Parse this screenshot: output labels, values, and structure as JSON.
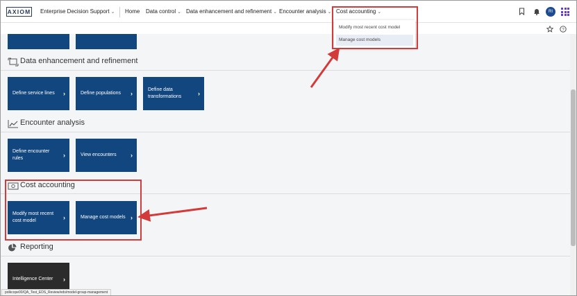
{
  "header": {
    "logo": "AXIOM",
    "product": "Enterprise Decision Support",
    "nav": [
      {
        "label": "Home",
        "has_menu": false
      },
      {
        "label": "Data control",
        "has_menu": true
      },
      {
        "label": "Data enhancement and refinement",
        "has_menu": true
      },
      {
        "label": "Encounter analysis",
        "has_menu": true
      },
      {
        "label": "Cost accounting",
        "has_menu": true
      }
    ],
    "avatar_initials": "RI",
    "icons": [
      "bookmark-icon",
      "bell-icon",
      "avatar",
      "apps-grid-icon"
    ]
  },
  "dropdown": {
    "items": [
      "Modify most recent cost model",
      "Manage cost models"
    ],
    "active_index": 1
  },
  "secondary_icons": [
    "star-icon",
    "help-icon"
  ],
  "sections": [
    {
      "title": "Data enhancement and refinement",
      "icon": "data-enhancement-icon",
      "tiles": [
        "Define service lines",
        "Define populations",
        "Define data transformations"
      ]
    },
    {
      "title": "Encounter analysis",
      "icon": "line-chart-icon",
      "tiles": [
        "Define encounter rules",
        "View encounters"
      ]
    },
    {
      "title": "Cost accounting",
      "icon": "cost-accounting-icon",
      "tiles": [
        "Modify most recent cost model",
        "Manage cost models"
      ]
    },
    {
      "title": "Reporting",
      "icon": "pie-chart-icon",
      "tiles": [
        "Intelligence Center"
      ]
    }
  ],
  "status_url": "polkcope00/QA_Test_EDS_Review/eds/model-group-management",
  "annotation_color": "#d33a3a",
  "tile_color": "#12467f"
}
